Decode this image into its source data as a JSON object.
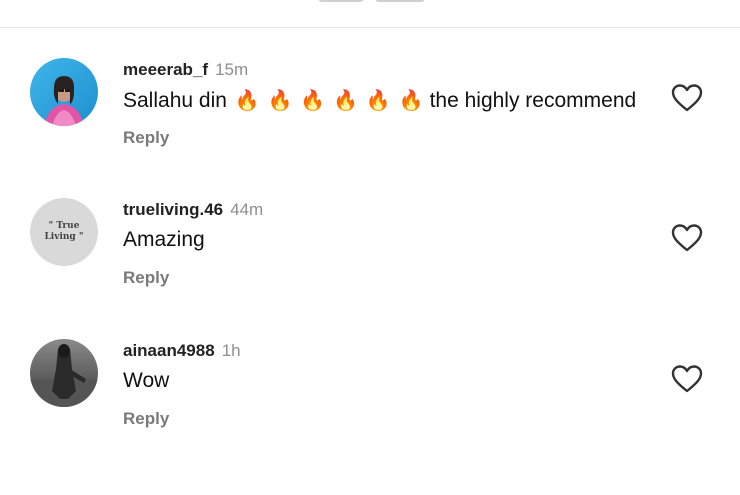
{
  "comments": [
    {
      "username": "meeerab_f",
      "time": "15m",
      "text_before": "Sallahu din",
      "emojis": [
        "🔥",
        "🔥",
        "🔥",
        "🔥",
        "🔥",
        "🔥"
      ],
      "text_after": "the highly recommend",
      "reply_label": "Reply",
      "avatar": "photo-girl-blue-background"
    },
    {
      "username": "trueliving.46",
      "time": "44m",
      "text": "Amazing",
      "reply_label": "Reply",
      "avatar_text_line1": "\" True",
      "avatar_text_line2": "Living \""
    },
    {
      "username": "ainaan4988",
      "time": "1h",
      "text": "Wow",
      "reply_label": "Reply",
      "avatar": "photo-grayscale-person"
    }
  ],
  "icons": {
    "like": "heart-outline-icon"
  },
  "colors": {
    "username": "#222222",
    "time": "#8e8e8e",
    "reply": "#7a7a7a",
    "divider": "#e6e6e6"
  }
}
